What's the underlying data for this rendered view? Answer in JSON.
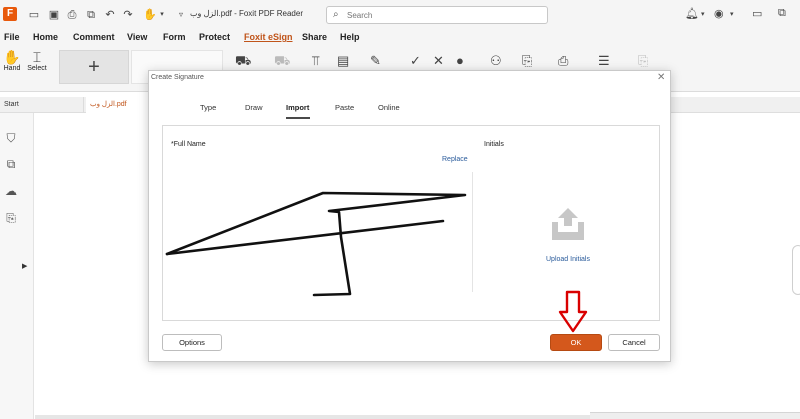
{
  "window": {
    "title": "الزل وب.pdf - Foxit PDF Reader",
    "search_placeholder": "Search"
  },
  "menu": [
    "File",
    "Home",
    "Comment",
    "View",
    "Form",
    "Protect",
    "Foxit eSign",
    "Share",
    "Help"
  ],
  "menu_active": "Foxit eSign",
  "ribbon": {
    "hand_label": "Hand",
    "select_label": "Select",
    "add_label": "+"
  },
  "tabs": {
    "start": "Start",
    "document": "الزل وب.pdf"
  },
  "dialog": {
    "title": "Create Signature",
    "tabs": [
      "Type",
      "Draw",
      "Import",
      "Paste",
      "Online"
    ],
    "active_tab": "Import",
    "full_name_label": "*Full Name",
    "replace_link": "Replace",
    "initials_label": "Initials",
    "upload_initials": "Upload Initials",
    "options_button": "Options",
    "ok_button": "OK",
    "cancel_button": "Cancel"
  },
  "colors": {
    "accent": "#c0541a",
    "ok_button": "#d4581c",
    "link": "#2a5b9b",
    "arrow": "#d90000"
  }
}
